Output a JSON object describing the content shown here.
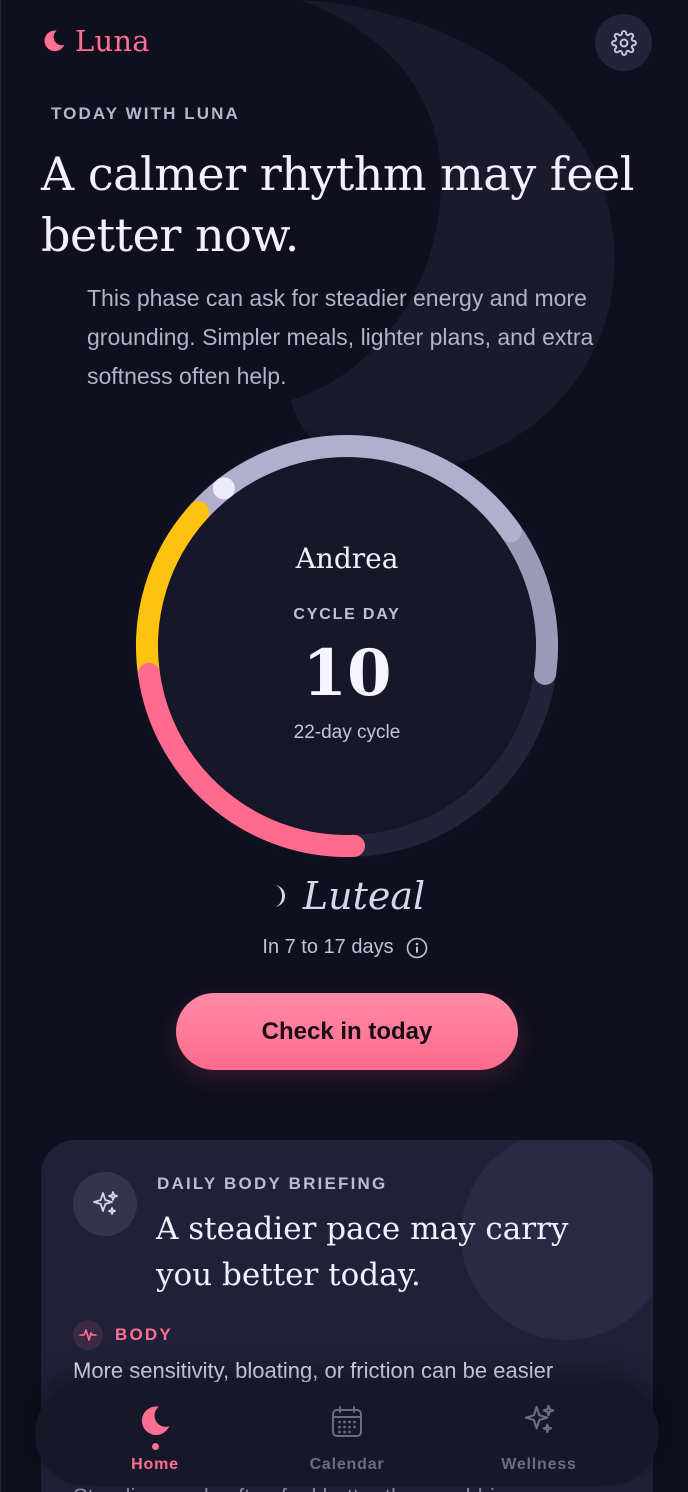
{
  "app": {
    "brand": "Luna"
  },
  "hero": {
    "eyebrow": "TODAY WITH LUNA",
    "headline": "A calmer rhythm may feel better now.",
    "intro": "This phase can ask for steadier energy and more grounding. Simpler meals, lighter plans, and extra softness often help."
  },
  "cycle": {
    "name": "Andrea",
    "label": "CYCLE DAY",
    "day": "10",
    "length_text": "22-day cycle",
    "cycle_length": 22,
    "current_day": 10,
    "phase": "Luteal",
    "next_text": "In 7 to 17 days",
    "colors": {
      "menstrual": "#ff6b8f",
      "follicular": "#ffc20f",
      "luteal": "#b2aecd",
      "track": "#23233a"
    }
  },
  "actions": {
    "checkin_label": "Check in today"
  },
  "briefing": {
    "eyebrow": "DAILY BODY BRIEFING",
    "title": "A steadier pace may carry you better today.",
    "body_tag": "BODY",
    "body_text": "More sensitivity, bloating, or friction can be easier",
    "body_text_2": "Steadier meals often feel better than grabbing"
  },
  "nav": {
    "home": "Home",
    "calendar": "Calendar",
    "wellness": "Wellness"
  }
}
